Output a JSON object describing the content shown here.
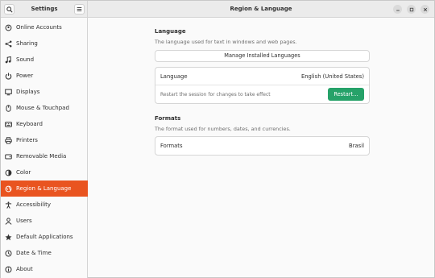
{
  "header": {
    "sidebar_title": "Settings",
    "title": "Region & Language",
    "search_icon": "search-icon",
    "menu_icon": "menu-icon"
  },
  "sidebar": {
    "items": [
      {
        "label": "Online Accounts",
        "icon": "online-accounts-icon"
      },
      {
        "label": "Sharing",
        "icon": "sharing-icon"
      },
      {
        "label": "Sound",
        "icon": "sound-icon"
      },
      {
        "label": "Power",
        "icon": "power-icon"
      },
      {
        "label": "Displays",
        "icon": "displays-icon"
      },
      {
        "label": "Mouse & Touchpad",
        "icon": "mouse-icon"
      },
      {
        "label": "Keyboard",
        "icon": "keyboard-icon"
      },
      {
        "label": "Printers",
        "icon": "printer-icon"
      },
      {
        "label": "Removable Media",
        "icon": "removable-media-icon"
      },
      {
        "label": "Color",
        "icon": "color-icon"
      },
      {
        "label": "Region & Language",
        "icon": "region-icon"
      },
      {
        "label": "Accessibility",
        "icon": "accessibility-icon"
      },
      {
        "label": "Users",
        "icon": "users-icon"
      },
      {
        "label": "Default Applications",
        "icon": "star-icon"
      },
      {
        "label": "Date & Time",
        "icon": "clock-icon"
      },
      {
        "label": "About",
        "icon": "info-icon"
      }
    ],
    "active": "Region & Language"
  },
  "language": {
    "title": "Language",
    "subtitle": "The language used for text in windows and web pages.",
    "manage_label": "Manage Installed Languages",
    "row_label": "Language",
    "row_value": "English (United States)",
    "restart_note": "Restart the session for changes to take effect",
    "restart_label": "Restart…"
  },
  "formats": {
    "title": "Formats",
    "subtitle": "The format used for numbers, dates, and currencies.",
    "row_label": "Formats",
    "row_value": "Brasil"
  },
  "colors": {
    "accent": "#e95420",
    "restart_button": "#26a269"
  }
}
